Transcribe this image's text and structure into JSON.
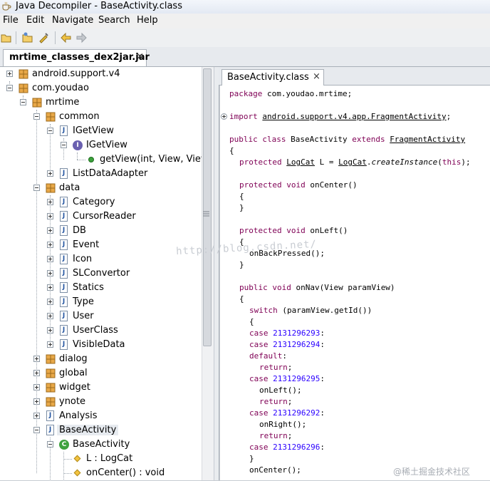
{
  "window": {
    "title": "Java Decompiler - BaseActivity.class"
  },
  "menu": [
    "File",
    "Edit",
    "Navigate",
    "Search",
    "Help"
  ],
  "toolbar": {
    "icons": [
      "open-file-icon",
      "open-folder-icon",
      "paste-icon",
      "back-arrow-icon",
      "forward-arrow-icon"
    ]
  },
  "file_tab": {
    "label": "mrtime_classes_dex2jar.jar",
    "close": "×"
  },
  "tree": {
    "android_support": "android.support.v4",
    "com_youdao": "com.youdao",
    "mrtime": "mrtime",
    "common": "common",
    "igetview_file": "IGetView",
    "igetview_iface": "IGetView",
    "getview_method": "getView(int, View, ViewG",
    "listdataadapter": "ListDataAdapter",
    "data": "data",
    "data_items": [
      "Category",
      "CursorReader",
      "DB",
      "Event",
      "Icon",
      "SLConvertor",
      "Statics",
      "Type",
      "User",
      "UserClass",
      "VisibleData"
    ],
    "dialog": "dialog",
    "global": "global",
    "widget": "widget",
    "ynote": "ynote",
    "analysis": "Analysis",
    "baseactivity_file": "BaseActivity",
    "baseactivity_class": "BaseActivity",
    "field_l": "L : LogCat",
    "oncenter_method": "onCenter() : void"
  },
  "editor_tab": {
    "label": "BaseActivity.class",
    "close": "×"
  },
  "code": {
    "package_kw": "package",
    "package_name": " com.youdao.mrtime;",
    "import_kw": "import",
    "import_name": "android.support.v4.app.FragmentActivity",
    "semicolon": ";",
    "class_kw": "public class",
    "class_name": " BaseActivity ",
    "extends_kw": "extends",
    "extends_name": "FragmentActivity",
    "open_brace": "{",
    "close_brace": "}",
    "field_kw": "protected",
    "field_type": "LogCat",
    "field_mid": " L = ",
    "field_call_cls": "LogCat",
    "field_call_dot": ".",
    "field_call_method": "createInstance",
    "field_call_open": "(",
    "this_kw": "this",
    "field_call_close": ");",
    "protected_void": "protected void",
    "oncenter_sig": " onCenter()",
    "onleft_sig": " onLeft()",
    "onbackpressed": "onBackPressed();",
    "public_void": "public void",
    "onnav_sig": " onNav(View paramView)",
    "switch_kw": "switch",
    "switch_expr": " (paramView.getId())",
    "case_kw": "case",
    "default_kw": "default",
    "colon": ":",
    "return_kw": "return",
    "case1": "2131296293",
    "case2": "2131296294",
    "case3": "2131296295",
    "case4": "2131296292",
    "case5": "2131296296",
    "onleft_call": "onLeft();",
    "onright_call": "onRight();",
    "oncenter_call": "onCenter();"
  },
  "watermark": "http://blog.csdn.net/",
  "source_mark": "@稀土掘金技术社区",
  "colors": {
    "keyword": "#7f0055",
    "literal": "#2a00ff",
    "title_bar": "#e3e9f3",
    "tree_lines": "#9aa3ad"
  }
}
